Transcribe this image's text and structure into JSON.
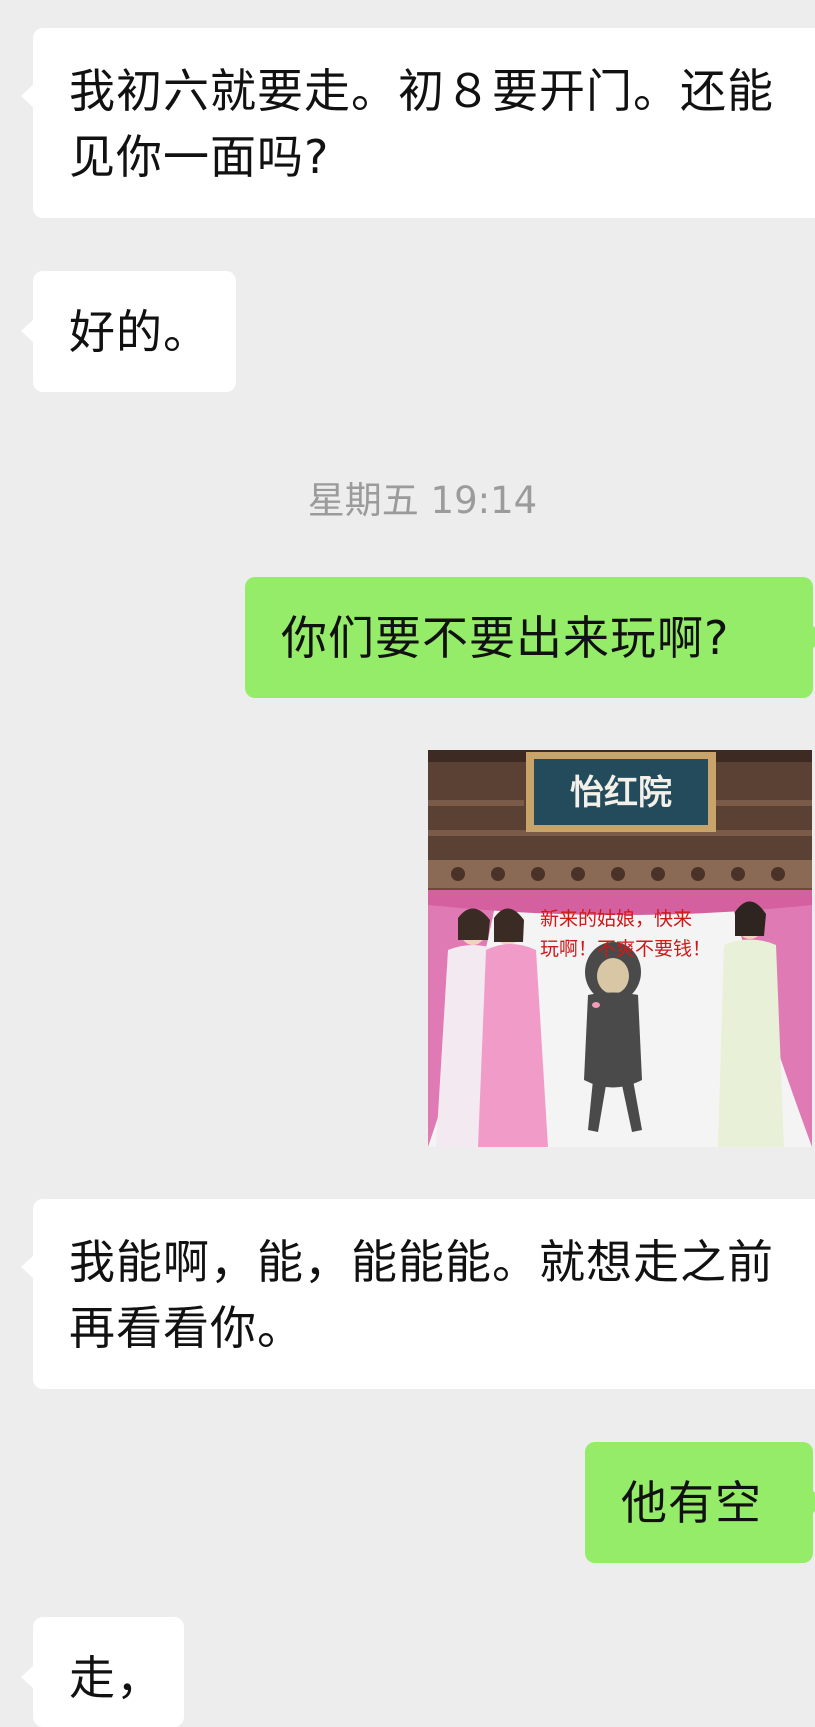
{
  "messages": {
    "m1": "我初六就要走。初８要开门。还能见你一面吗?",
    "m2": "好的。",
    "timestamp": "星期五 19:14",
    "m3": "你们要不要出来玩啊?",
    "sticker": {
      "sign": "怡红院",
      "caption_line1": "新来的姑娘，快来",
      "caption_line2": "玩啊！不爽不要钱！"
    },
    "m4": "我能啊，能，能能能。就想走之前再看看你。",
    "m5": "他有空",
    "m6": "走，"
  },
  "colors": {
    "background": "#ededed",
    "incoming_bubble": "#ffffff",
    "outgoing_bubble": "#95ec69",
    "timestamp_text": "#9b9b9b"
  }
}
